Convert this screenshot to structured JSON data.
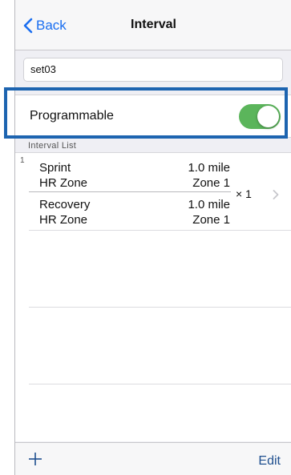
{
  "nav": {
    "back_label": "Back",
    "title": "Interval"
  },
  "name_field": {
    "value": "set03"
  },
  "programmable": {
    "label": "Programmable",
    "enabled": true
  },
  "interval_list": {
    "header": "Interval List",
    "items": [
      {
        "index": "1",
        "segments": [
          {
            "type": "Sprint",
            "distance": "1.0 mile",
            "zone_label": "HR Zone",
            "zone_value": "Zone 1"
          },
          {
            "type": "Recovery",
            "distance": "1.0 mile",
            "zone_label": "HR Zone",
            "zone_value": "Zone 1"
          }
        ],
        "repeat": "× 1"
      }
    ]
  },
  "toolbar": {
    "edit_label": "Edit"
  },
  "colors": {
    "accent": "#1a6ef0",
    "toggle_on": "#5bb55b",
    "highlight": "#1d64b0"
  },
  "icons": {
    "back": "chevron-left-icon",
    "add": "plus-icon",
    "disclosure": "chevron-right-icon"
  }
}
